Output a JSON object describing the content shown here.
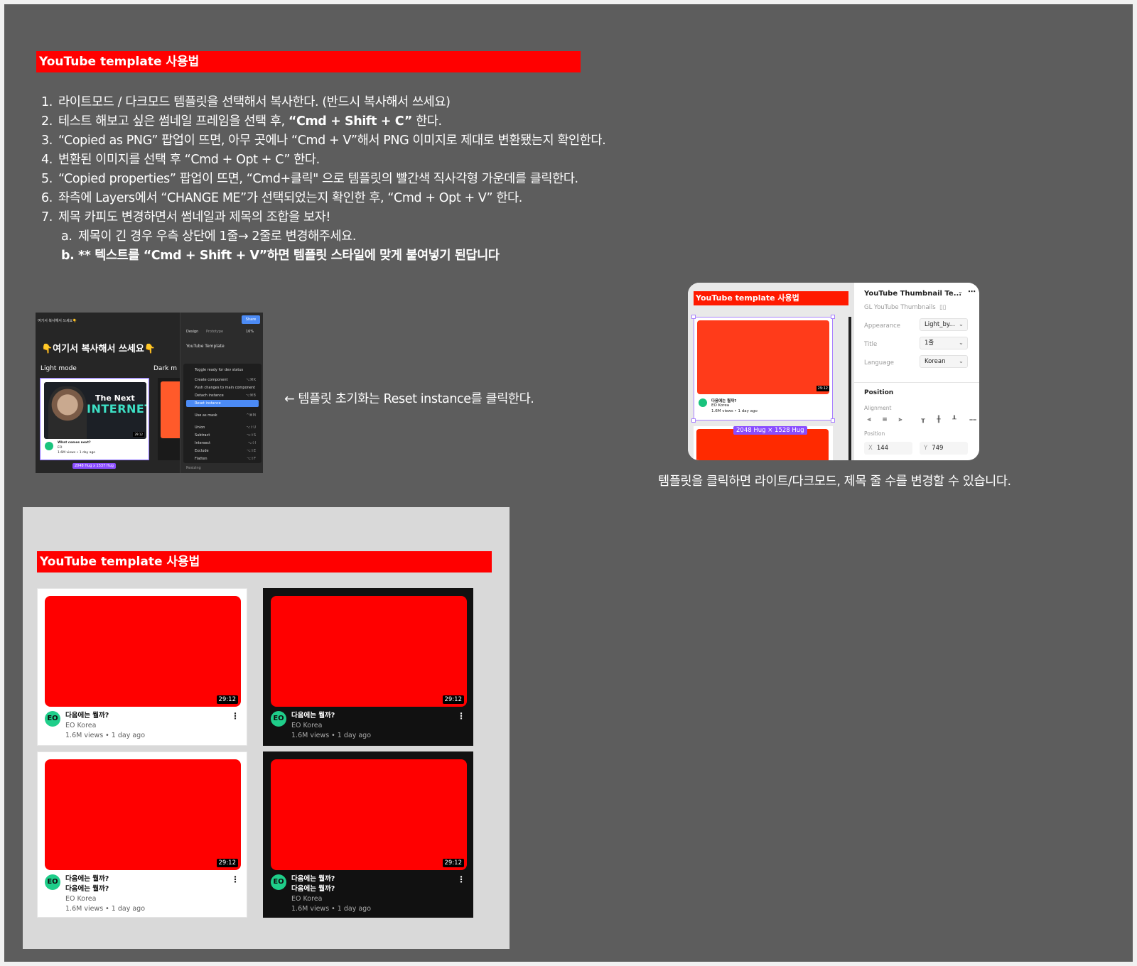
{
  "colors": {
    "brand_red": "#ff0000",
    "canvas_bg": "#5d5d5d",
    "frame_bg": "#d9d9d9",
    "avatar_green": "#1fce8a",
    "selection_purple": "#8a4dff"
  },
  "header": {
    "title": "YouTube template 사용법"
  },
  "instructions": {
    "steps": [
      {
        "num": "1.",
        "text": "라이트모드 / 다크모드 템플릿을 선택해서 복사한다. (반드시 복사해서 쓰세요)"
      },
      {
        "num": "2.",
        "pre": "테스트 해보고 싶은 썸네일 프레임을 선택 후, ",
        "bold": "“Cmd + Shift + C”",
        "post": " 한다."
      },
      {
        "num": "3.",
        "text": "“Copied as PNG” 팝업이 뜨면, 아무 곳에나 “Cmd + V”해서 PNG 이미지로 제대로 변환됐는지 확인한다."
      },
      {
        "num": "4.",
        "text": "변환된 이미지를 선택 후 “Cmd + Opt + C” 한다."
      },
      {
        "num": "5.",
        "text": "“Copied properties” 팝업이 뜨면, “Cmd+클릭\" 으로 템플릿의 빨간색 직사각형 가운데를 클릭한다."
      },
      {
        "num": "6.",
        "text": "좌측에 Layers에서 “CHANGE ME”가 선택되었는지 확인한 후, “Cmd + Opt + V” 한다."
      },
      {
        "num": "7.",
        "text": "제목 카피도 변경하면서 썸네일과 제목의 조합을 보자!"
      }
    ],
    "substeps": [
      {
        "num": "a.",
        "text": "제목이 긴 경우 우측 상단에 1줄→ 2줄로 변경해주세요."
      },
      {
        "num": "b.",
        "text": "** 텍스트를 “Cmd + Shift + V”하면 템플릿 스타일에 맞게 붙여넣기 된답니다"
      }
    ]
  },
  "screenshot_menu": {
    "top_label": "여기서 복사해서 쓰세요👇",
    "banner": "👇여기서 복사해서 쓰세요👇",
    "light_mode": "Light mode",
    "dark_mode": "Dark m",
    "thumb_title_1": "The Next",
    "thumb_title_2": "INTERNET",
    "thumb_duration": "29:12",
    "card_title": "What comes next?",
    "card_channel": "EO",
    "card_meta": "1.6M views • 1 day ago",
    "hug": "2048 Hug x 1537 Hug",
    "share": "Share",
    "tab_design": "Design",
    "tab_prototype": "Prototype",
    "zoom": "16%",
    "component_name": "YouTube Template",
    "menu_items": [
      {
        "label": "Toggle ready for dev status",
        "shortcut": ""
      },
      {
        "label": "Create component",
        "shortcut": "⌥⌘K"
      },
      {
        "label": "Push changes to main component",
        "shortcut": ""
      },
      {
        "label": "Detach instance",
        "shortcut": "⌥⌘B"
      },
      {
        "label": "Reset instance",
        "shortcut": ""
      },
      {
        "label": "Use as mask",
        "shortcut": "^⌘M"
      },
      {
        "label": "Union",
        "shortcut": "⌥⇧U"
      },
      {
        "label": "Subtract",
        "shortcut": "⌥⇧S"
      },
      {
        "label": "Intersect",
        "shortcut": "⌥⇧I"
      },
      {
        "label": "Exclude",
        "shortcut": "⌥⇧E"
      },
      {
        "label": "Flatten",
        "shortcut": "⌥⇧F"
      }
    ],
    "resizing": "Resizing"
  },
  "reset_note": "← 템플릿 초기화는 Reset instance를 클릭한다.",
  "screenshot_props": {
    "bar_title": "YouTube template 사용법",
    "component_title": "YouTube Thumbnail Te...",
    "library": "GL YouTube Thumbnails",
    "appearance_label": "Appearance",
    "appearance_value": "Light_by...",
    "title_label": "Title",
    "title_value": "1줄",
    "language_label": "Language",
    "language_value": "Korean",
    "position_heading": "Position",
    "alignment_label": "Alignment",
    "position_label": "Position",
    "x_label": "X",
    "x_value": "144",
    "y_label": "Y",
    "y_value": "749",
    "hug": "2048 Hug × 1528 Hug",
    "card_title": "다음에는 뭘까?",
    "card_channel": "EO Korea",
    "card_meta": "1.6M views • 1 day ago",
    "duration": "29:12"
  },
  "props_caption": "템플릿을 클릭하면 라이트/다크모드, 제목 줄 수를 변경할 수 있습니다.",
  "template_frame": {
    "title": "YouTube template 사용법",
    "avatar_text": "EO",
    "cards": [
      {
        "mode": "light",
        "title_lines": [
          "다음에는 뭘까?"
        ],
        "channel": "EO Korea",
        "meta": "1.6M views • 1 day ago",
        "duration": "29:12"
      },
      {
        "mode": "dark",
        "title_lines": [
          "다음에는 뭘까?"
        ],
        "channel": "EO Korea",
        "meta": "1.6M views • 1 day ago",
        "duration": "29:12"
      },
      {
        "mode": "light",
        "title_lines": [
          "다음에는 뭘까?",
          "다음에는 뭘까?"
        ],
        "channel": "EO Korea",
        "meta": "1.6M views • 1 day ago",
        "duration": "29:12"
      },
      {
        "mode": "dark",
        "title_lines": [
          "다음에는 뭘까?",
          "다음에는 뭘까?"
        ],
        "channel": "EO Korea",
        "meta": "1.6M views • 1 day ago",
        "duration": "29:12"
      }
    ]
  }
}
